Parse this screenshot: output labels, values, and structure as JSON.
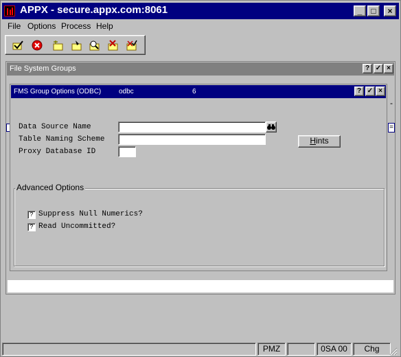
{
  "window": {
    "title": "APPX - secure.appx.com:8061",
    "min_btn": "_",
    "max_btn": "□",
    "close_btn": "×"
  },
  "menu": {
    "items": [
      "File",
      "Options",
      "Process",
      "Help"
    ]
  },
  "toolbar": {
    "buttons": [
      {
        "icon": "checkmark-icon"
      },
      {
        "icon": "cancel-icon"
      },
      {
        "icon": "add-record-icon"
      },
      {
        "icon": "change-record-icon"
      },
      {
        "icon": "inquire-record-icon"
      },
      {
        "icon": "delete-record-icon"
      },
      {
        "icon": "review-record-icon"
      }
    ]
  },
  "fsg_window": {
    "title": "File System Groups",
    "help": "?",
    "ok": "✓",
    "close": "×",
    "side_mark_1": "-",
    "side_mark_2": "="
  },
  "fms_window": {
    "title": "FMS Group Options (ODBC)",
    "engine": "odbc",
    "number": "6",
    "help": "?",
    "ok": "✓",
    "close": "×"
  },
  "fields": {
    "data_source_label": "Data Source Name",
    "data_source_value": "",
    "naming_scheme_label": "Table Naming Scheme",
    "naming_scheme_value": "",
    "proxy_db_label": "Proxy Database ID",
    "proxy_db_value": ""
  },
  "hints_button": {
    "first": "H",
    "rest": "ints"
  },
  "advanced": {
    "legend": "Advanced Options",
    "suppress_label": "Suppress Null Numerics?",
    "suppress_value": "?",
    "read_label": "Read Uncommitted?",
    "read_value": "?"
  },
  "status": {
    "cell1": "",
    "cell2": "",
    "cell3": "PMZ",
    "cell4": "",
    "cell5": "0SA 00",
    "cell6": "Chg"
  },
  "colors": {
    "active_title": "#000080",
    "inactive_title": "#808080",
    "face": "#c0c0c0"
  }
}
